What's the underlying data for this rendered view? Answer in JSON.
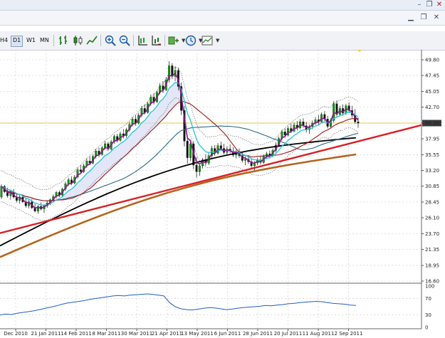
{
  "toolbar": {
    "timeframes": [
      {
        "label": "H4",
        "active": false
      },
      {
        "label": "D1",
        "active": true
      },
      {
        "label": "W1",
        "active": false
      },
      {
        "label": "MN",
        "active": false
      }
    ],
    "icons": [
      "bar-chart-icon",
      "candlestick-icon",
      "line-chart-icon",
      "zoom-in-icon",
      "zoom-out-icon",
      "chart-shift-icon",
      "auto-scroll-icon",
      "indicators-icon",
      "periods-icon",
      "templates-icon"
    ]
  },
  "colors": {
    "grid": "#c8c8c8",
    "candle_up": "#00a000",
    "candle_down": "#111111",
    "ma_purple": "#8b1a8b",
    "ma_cyan": "#22c4d8",
    "ma_darkred": "#a01818",
    "ma_teal": "#2b6a8a",
    "ma_black": "#000000",
    "ma_orange": "#b5651d",
    "trendline": "#d81f26",
    "price_line": "#e6c84a",
    "rsi": "#1f5fc0",
    "cloud_fill": "#d9ddf4"
  },
  "chart_data": [
    {
      "type": "line",
      "panel": "price",
      "y_axis_labels": [
        "49.80",
        "47.45",
        "45.05",
        "42.70",
        "40.30",
        "37.95",
        "35.55",
        "33.20",
        "30.85",
        "28.45",
        "26.10",
        "23.70",
        "21.35",
        "18.95",
        "16.60"
      ],
      "x_axis_labels": [
        "Dec 2010",
        "21 Jan 2011",
        "14 Feb 2011",
        "8 Mar 2011",
        "30 Mar 2011",
        "21 Apr 2011",
        "13 May 2011",
        "6 Jun 2011",
        "28 Jun 2011",
        "20 Jul 2011",
        "11 Aug 2011",
        "2 Sep 2011"
      ],
      "current_price": "40.30",
      "ylim": [
        16.6,
        49.8
      ],
      "candles": [
        [
          29.2,
          31.1,
          28.9,
          30.8
        ],
        [
          30.8,
          31.0,
          29.8,
          30.0
        ],
        [
          30.0,
          30.6,
          29.1,
          29.4
        ],
        [
          29.4,
          30.2,
          28.8,
          29.9
        ],
        [
          29.9,
          30.4,
          29.0,
          29.2
        ],
        [
          29.2,
          29.8,
          28.4,
          28.7
        ],
        [
          28.7,
          29.5,
          28.2,
          29.2
        ],
        [
          29.2,
          29.6,
          28.3,
          28.5
        ],
        [
          28.5,
          29.0,
          27.6,
          27.9
        ],
        [
          27.9,
          28.8,
          27.5,
          28.5
        ],
        [
          28.5,
          28.9,
          27.4,
          27.6
        ],
        [
          27.6,
          28.2,
          26.9,
          27.1
        ],
        [
          27.1,
          28.0,
          26.7,
          27.8
        ],
        [
          27.8,
          28.4,
          27.2,
          27.4
        ],
        [
          27.4,
          28.1,
          26.8,
          27.9
        ],
        [
          27.9,
          28.6,
          27.6,
          28.3
        ],
        [
          28.3,
          29.0,
          28.0,
          28.8
        ],
        [
          28.8,
          29.6,
          28.5,
          29.3
        ],
        [
          29.3,
          30.1,
          29.0,
          29.9
        ],
        [
          29.9,
          30.2,
          29.2,
          29.5
        ],
        [
          29.5,
          30.6,
          29.3,
          30.4
        ],
        [
          30.4,
          31.5,
          30.1,
          31.2
        ],
        [
          31.2,
          32.1,
          30.9,
          31.8
        ],
        [
          31.8,
          32.3,
          31.0,
          31.3
        ],
        [
          31.3,
          32.5,
          31.1,
          32.2
        ],
        [
          32.2,
          33.6,
          32.0,
          33.3
        ],
        [
          33.3,
          34.0,
          32.7,
          33.0
        ],
        [
          33.0,
          34.2,
          32.8,
          33.9
        ],
        [
          33.9,
          35.0,
          33.6,
          34.6
        ],
        [
          34.6,
          35.3,
          34.0,
          34.3
        ],
        [
          34.3,
          35.6,
          34.1,
          35.3
        ],
        [
          35.3,
          36.4,
          35.0,
          36.1
        ],
        [
          36.1,
          36.6,
          35.2,
          35.6
        ],
        [
          35.6,
          36.9,
          35.4,
          36.6
        ],
        [
          36.6,
          37.6,
          36.3,
          37.2
        ],
        [
          37.2,
          37.5,
          36.1,
          36.4
        ],
        [
          36.4,
          37.8,
          36.2,
          37.5
        ],
        [
          37.5,
          38.6,
          37.2,
          38.3
        ],
        [
          38.3,
          38.7,
          37.4,
          37.7
        ],
        [
          37.7,
          39.0,
          37.5,
          38.7
        ],
        [
          38.7,
          39.4,
          38.0,
          38.4
        ],
        [
          38.4,
          39.6,
          38.1,
          39.3
        ],
        [
          39.3,
          40.5,
          39.0,
          40.1
        ],
        [
          40.1,
          41.2,
          39.8,
          40.9
        ],
        [
          40.9,
          41.5,
          39.9,
          40.3
        ],
        [
          40.3,
          41.8,
          40.1,
          41.5
        ],
        [
          41.5,
          42.9,
          41.2,
          42.5
        ],
        [
          42.5,
          43.1,
          41.6,
          41.9
        ],
        [
          41.9,
          43.5,
          41.7,
          43.2
        ],
        [
          43.2,
          44.6,
          42.9,
          44.2
        ],
        [
          44.2,
          44.8,
          43.1,
          43.5
        ],
        [
          43.5,
          45.2,
          43.3,
          44.9
        ],
        [
          44.9,
          46.3,
          44.6,
          45.9
        ],
        [
          45.9,
          46.6,
          44.8,
          45.3
        ],
        [
          45.3,
          47.2,
          45.1,
          46.8
        ],
        [
          46.8,
          49.6,
          46.4,
          48.9
        ],
        [
          48.9,
          49.3,
          46.9,
          47.3
        ],
        [
          47.3,
          48.8,
          46.6,
          48.2
        ],
        [
          48.2,
          48.6,
          45.2,
          45.8
        ],
        [
          45.8,
          46.4,
          41.5,
          42.2
        ],
        [
          42.2,
          42.9,
          36.8,
          37.6
        ],
        [
          37.6,
          38.5,
          34.2,
          35.1
        ],
        [
          35.1,
          37.8,
          34.6,
          37.2
        ],
        [
          37.2,
          37.6,
          33.4,
          34.0
        ],
        [
          34.0,
          35.2,
          32.1,
          33.0
        ],
        [
          33.0,
          34.3,
          32.4,
          33.9
        ],
        [
          33.9,
          35.1,
          33.5,
          34.8
        ],
        [
          34.8,
          35.6,
          33.9,
          34.3
        ],
        [
          34.3,
          35.8,
          34.0,
          35.4
        ],
        [
          35.4,
          36.9,
          35.1,
          36.5
        ],
        [
          36.5,
          37.0,
          35.4,
          35.8
        ],
        [
          35.8,
          37.3,
          35.6,
          36.9
        ],
        [
          36.9,
          37.5,
          36.2,
          36.5
        ],
        [
          36.5,
          37.2,
          35.6,
          35.9
        ],
        [
          35.9,
          36.8,
          35.4,
          36.4
        ],
        [
          36.4,
          37.1,
          35.8,
          36.1
        ],
        [
          36.1,
          36.7,
          35.2,
          35.5
        ],
        [
          35.5,
          36.3,
          35.0,
          36.0
        ],
        [
          36.0,
          36.5,
          35.1,
          35.4
        ],
        [
          35.4,
          35.9,
          34.4,
          34.7
        ],
        [
          34.7,
          35.3,
          34.0,
          34.9
        ],
        [
          34.9,
          35.5,
          34.2,
          34.5
        ],
        [
          34.5,
          35.0,
          33.6,
          33.9
        ],
        [
          33.9,
          34.6,
          33.2,
          34.3
        ],
        [
          34.3,
          35.1,
          34.0,
          34.8
        ],
        [
          34.8,
          35.4,
          34.1,
          34.4
        ],
        [
          34.4,
          35.6,
          34.2,
          35.3
        ],
        [
          35.3,
          36.0,
          34.9,
          35.7
        ],
        [
          35.7,
          36.2,
          35.0,
          35.4
        ],
        [
          35.4,
          36.5,
          35.2,
          36.2
        ],
        [
          36.2,
          37.4,
          35.9,
          37.0
        ],
        [
          37.0,
          38.3,
          36.7,
          38.0
        ],
        [
          38.0,
          39.3,
          37.7,
          39.0
        ],
        [
          39.0,
          39.5,
          38.1,
          38.5
        ],
        [
          38.5,
          39.8,
          38.3,
          39.5
        ],
        [
          39.5,
          40.2,
          38.8,
          39.1
        ],
        [
          39.1,
          40.4,
          38.9,
          40.0
        ],
        [
          40.0,
          40.6,
          39.2,
          39.6
        ],
        [
          39.6,
          40.9,
          39.4,
          40.5
        ],
        [
          40.5,
          41.0,
          39.6,
          39.9
        ],
        [
          39.9,
          40.5,
          38.9,
          39.3
        ],
        [
          39.3,
          40.1,
          38.7,
          39.8
        ],
        [
          39.8,
          40.7,
          39.4,
          40.3
        ],
        [
          40.3,
          41.2,
          40.0,
          40.8
        ],
        [
          40.8,
          41.5,
          40.1,
          40.5
        ],
        [
          40.5,
          41.9,
          40.3,
          41.6
        ],
        [
          41.6,
          42.1,
          40.6,
          40.9
        ],
        [
          40.9,
          41.4,
          39.5,
          39.8
        ],
        [
          39.8,
          41.0,
          39.6,
          40.7
        ],
        [
          40.7,
          43.6,
          40.4,
          43.2
        ],
        [
          43.2,
          43.7,
          41.2,
          41.6
        ],
        [
          41.6,
          42.9,
          41.3,
          42.5
        ],
        [
          42.5,
          43.1,
          41.4,
          41.8
        ],
        [
          41.8,
          43.2,
          41.5,
          42.9
        ],
        [
          42.9,
          43.4,
          41.8,
          42.2
        ],
        [
          42.2,
          42.9,
          41.1,
          41.5
        ],
        [
          41.5,
          42.4,
          40.2,
          40.5
        ],
        [
          40.5,
          41.1,
          39.6,
          40.3
        ]
      ]
    },
    {
      "type": "line",
      "panel": "oscillator",
      "y_axis_labels": [
        "100",
        "70",
        "30",
        "0"
      ],
      "ylim": [
        0,
        100
      ],
      "values": [
        30,
        32,
        31,
        34,
        36,
        38,
        40,
        43,
        46,
        49,
        52,
        56,
        59,
        61,
        63,
        65,
        68,
        70,
        72,
        74,
        76,
        77,
        76,
        78,
        79,
        80,
        81,
        80,
        78,
        76,
        60,
        50,
        45,
        43,
        42,
        44,
        46,
        48,
        47,
        45,
        43,
        44,
        46,
        48,
        49,
        50,
        51,
        53,
        52,
        54,
        55,
        57,
        58,
        60,
        61,
        62,
        63,
        62,
        60,
        58,
        57,
        56,
        54,
        53
      ]
    }
  ]
}
